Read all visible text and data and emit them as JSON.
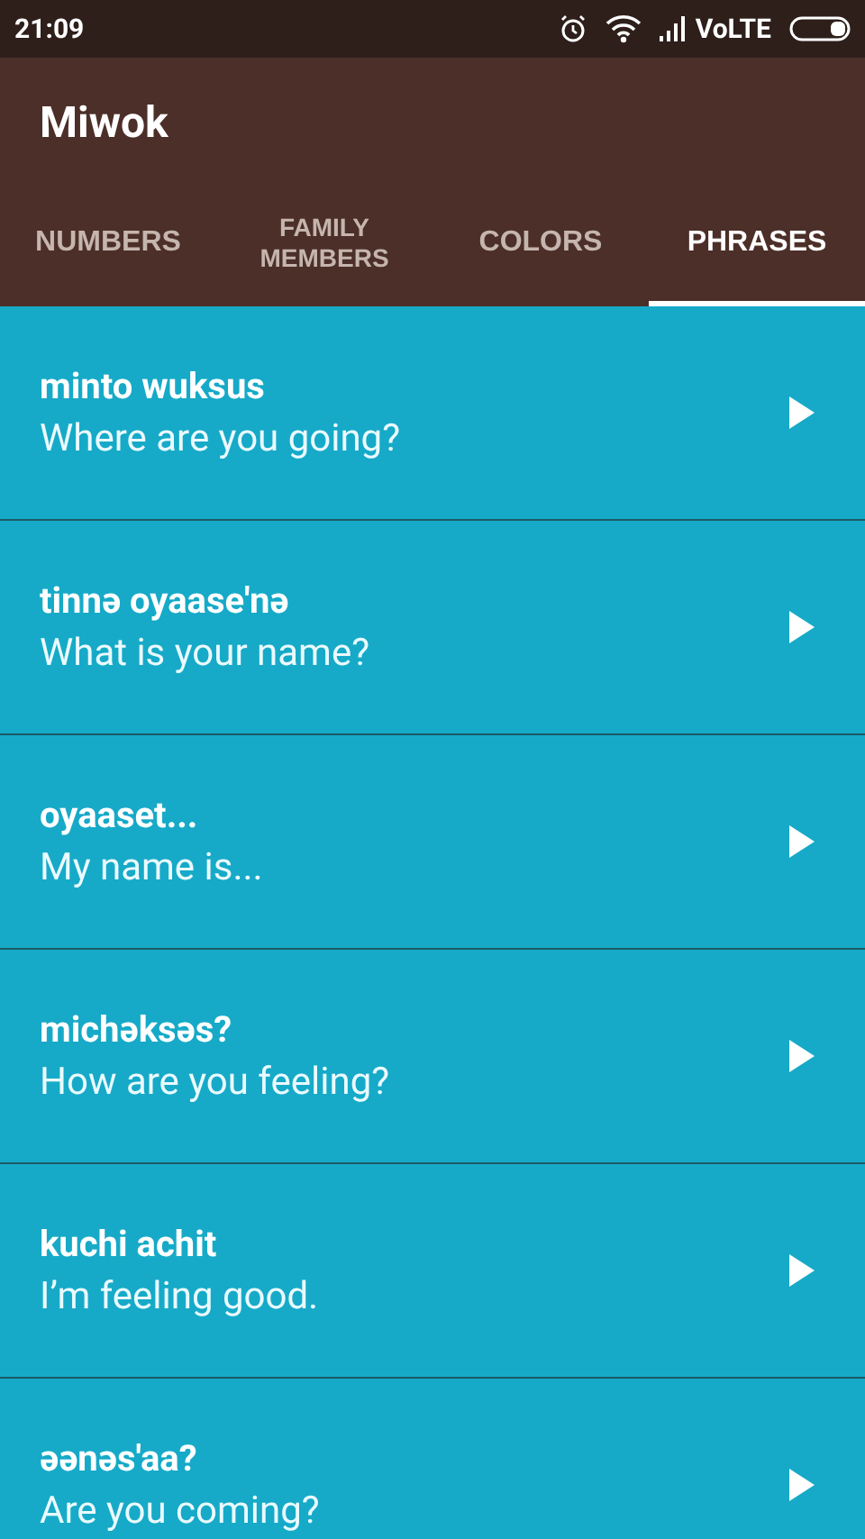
{
  "status_bar": {
    "time": "21:09",
    "network": "VoLTE"
  },
  "app_bar": {
    "title": "Miwok"
  },
  "tabs": [
    {
      "label": "NUMBERS",
      "selected": false
    },
    {
      "label": "FAMILY MEMBERS",
      "selected": false
    },
    {
      "label": "COLORS",
      "selected": false
    },
    {
      "label": "PHRASES",
      "selected": true
    }
  ],
  "phrases": [
    {
      "miwok": "minto wuksus",
      "english": "Where are you going?"
    },
    {
      "miwok": "tinnə oyaase'nə",
      "english": "What is your name?"
    },
    {
      "miwok": "oyaaset...",
      "english": "My name is..."
    },
    {
      "miwok": "michəksəs?",
      "english": "How are you feeling?"
    },
    {
      "miwok": "kuchi achit",
      "english": "I’m feeling good."
    },
    {
      "miwok": "əənəs'aa?",
      "english": "Are you coming?"
    }
  ]
}
